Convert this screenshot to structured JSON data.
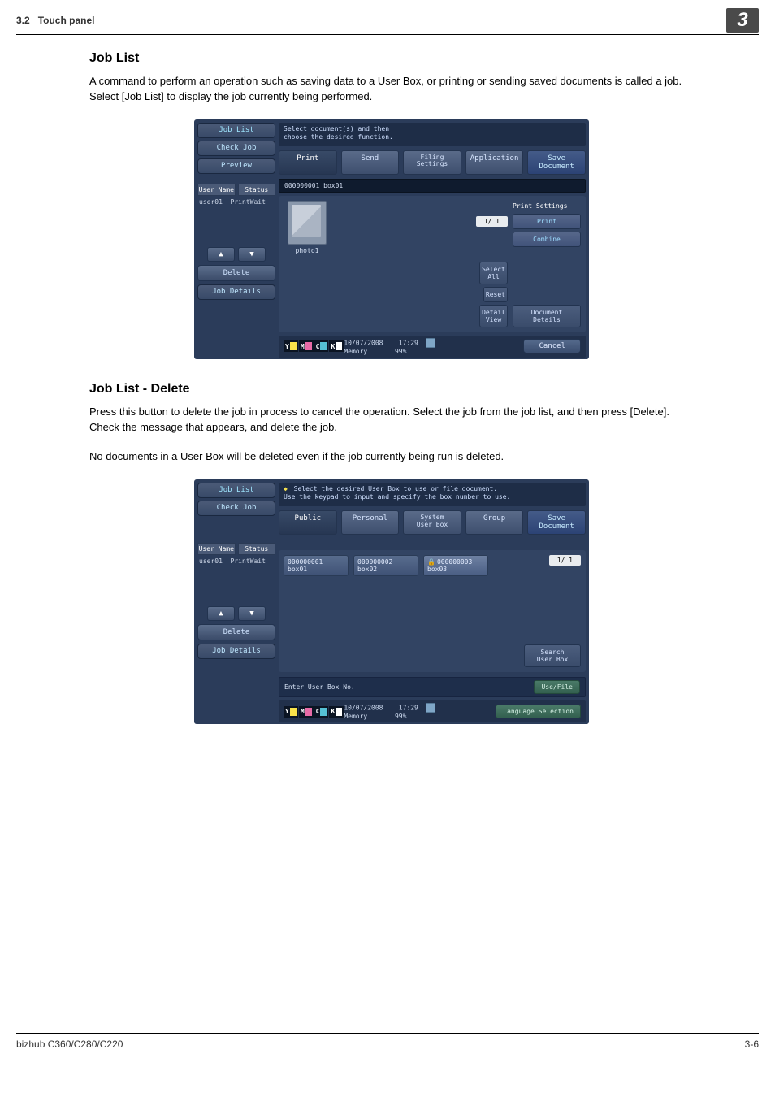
{
  "header": {
    "section_no": "3.2",
    "section_title": "Touch panel",
    "chapter_no": "3"
  },
  "sec1": {
    "heading": "Job List",
    "body": "A command to perform an operation such as saving data to a User Box, or printing or sending saved documents is called a job. Select [Job List] to display the job currently being performed."
  },
  "sec2": {
    "heading": "Job List - Delete",
    "body1": "Press this button to delete the job in process to cancel the operation. Select the job from the job list, and then press [Delete]. Check the message that appears, and delete the job.",
    "body2": "No documents in a User Box will be deleted even if the job currently being run is deleted."
  },
  "panel1": {
    "tip": "Select document(s) and then\nchoose the desired function.",
    "left_tabs": {
      "job_list": "Job List",
      "check_job": "Check Job",
      "preview": "Preview"
    },
    "list_header": {
      "user": "User\nName",
      "status": "Status"
    },
    "list_row": {
      "user": "user01",
      "status": "PrintWait"
    },
    "delete": "Delete",
    "job_details": "Job Details",
    "top_tabs": {
      "print": "Print",
      "send": "Send",
      "filing": "Filing\nSettings",
      "application": "Application",
      "save": "Save Document"
    },
    "breadcrumb": "000000001   box01",
    "thumb_label": "photo1",
    "pager": "1/  1",
    "right_label": "Print Settings",
    "right_buttons": {
      "print": "Print",
      "combine": "Combine"
    },
    "mid_buttons": {
      "select_all": "Select\nAll",
      "reset": "Reset",
      "detail_view": "Detail\nView"
    },
    "doc_details": "Document\nDetails",
    "cancel": "Cancel",
    "status": {
      "date": "10/07/2008",
      "time": "17:29",
      "memory": "Memory",
      "memval": "99%"
    }
  },
  "panel2": {
    "tip": "Select the desired User Box to use or file document.\nUse the keypad to input and specify the box number to use.",
    "left_tabs": {
      "job_list": "Job List",
      "check_job": "Check Job"
    },
    "list_header": {
      "user": "User\nName",
      "status": "Status"
    },
    "list_row": {
      "user": "user01",
      "status": "PrintWait"
    },
    "delete": "Delete",
    "job_details": "Job Details",
    "top_tabs": {
      "public": "Public",
      "personal": "Personal",
      "system": "System\nUser Box",
      "group": "Group",
      "save": "Save Document"
    },
    "boxes": [
      {
        "id": "000000001",
        "name": "box01"
      },
      {
        "id": "000000002",
        "name": "box02"
      },
      {
        "id": "000000003",
        "name": "box03",
        "locked": true
      }
    ],
    "pager": "1/  1",
    "search": "Search\nUser Box",
    "enter_box": "Enter User Box No.",
    "use_file": "Use/File",
    "lang": "Language Selection",
    "status": {
      "date": "10/07/2008",
      "time": "17:29",
      "memory": "Memory",
      "memval": "99%"
    }
  },
  "footer": {
    "model": "bizhub C360/C280/C220",
    "page": "3-6"
  }
}
